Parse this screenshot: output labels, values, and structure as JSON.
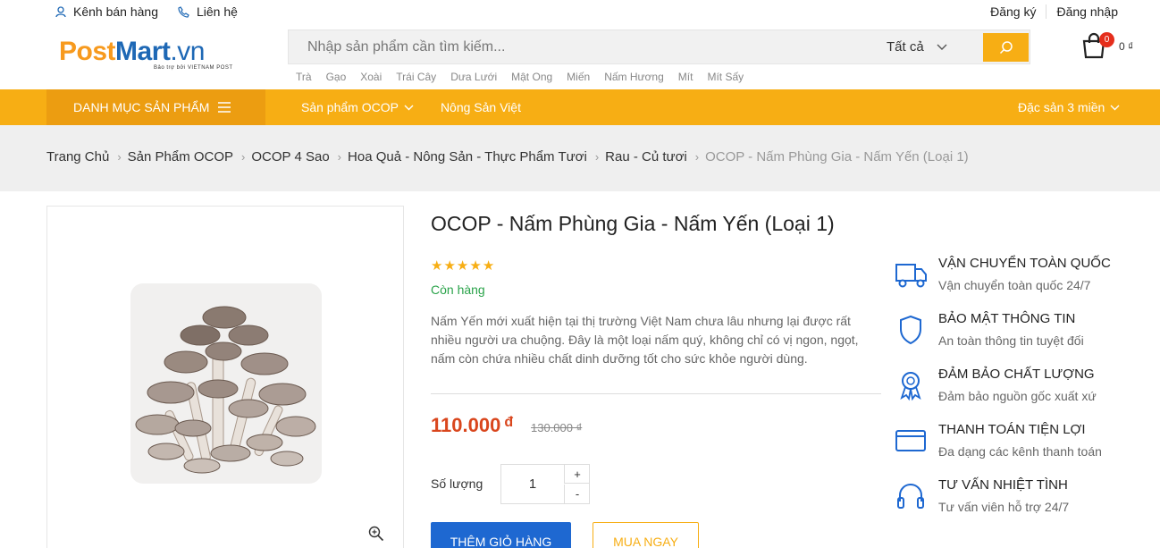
{
  "topbar": {
    "seller_channel": "Kênh bán hàng",
    "contact": "Liên hệ",
    "register": "Đăng ký",
    "login": "Đăng nhập"
  },
  "logo": {
    "part1": "Post",
    "part2": "Mart",
    "part3": ".vn",
    "tagline": "Bảo trợ bởi VIETNAM POST"
  },
  "search": {
    "placeholder": "Nhập sản phẩm cần tìm kiếm...",
    "category": "Tất cả"
  },
  "tags": [
    "Trà",
    "Gạo",
    "Xoài",
    "Trái Cây",
    "Dưa Lưới",
    "Mật Ong",
    "Miến",
    "Nấm Hương",
    "Mít",
    "Mít Sấy"
  ],
  "cart": {
    "count": "0",
    "total": "0 ₫"
  },
  "nav": {
    "categories": "DANH MỤC SẢN PHẨM",
    "menu": [
      "Sản phẩm OCOP",
      "Nông Sản Việt"
    ],
    "right": "Đặc sản 3 miền"
  },
  "breadcrumb": [
    "Trang Chủ",
    "Sản Phẩm OCOP",
    "OCOP 4 Sao",
    "Hoa Quả - Nông Sản - Thực Phẩm Tươi",
    "Rau - Củ tươi",
    "OCOP - Nấm Phùng Gia - Nấm Yến (Loại 1)"
  ],
  "product": {
    "title": "OCOP - Nấm Phùng Gia - Nấm Yến (Loại 1)",
    "rating": 5,
    "stock": "Còn hàng",
    "description": "Nấm Yến mới xuất hiện tại thị trường Việt Nam chưa lâu nhưng lại được rất nhiều người ưa chuộng. Đây là một loại nấm quý, không chỉ có vị ngon, ngọt, nấm còn chứa nhiều chất dinh dưỡng tốt cho sức khỏe người dùng.",
    "price": "110.000",
    "currency": "đ",
    "old_price": "130.000 ₫",
    "quantity_label": "Số lượng",
    "quantity": "1",
    "plus": "+",
    "minus": "-",
    "add_to_cart": "THÊM GIỎ HÀNG",
    "buy_now": "MUA NGAY"
  },
  "features": [
    {
      "title": "VẬN CHUYỂN TOÀN QUỐC",
      "subtitle": "Vận chuyển toàn quốc 24/7",
      "icon": "truck-icon"
    },
    {
      "title": "BẢO MẬT THÔNG TIN",
      "subtitle": "An toàn thông tin tuyệt đối",
      "icon": "shield-icon"
    },
    {
      "title": "ĐẢM BẢO CHẤT LƯỢNG",
      "subtitle": "Đảm bảo nguồn gốc xuất xứ",
      "icon": "award-icon"
    },
    {
      "title": "THANH TOÁN TIỆN LỢI",
      "subtitle": "Đa dạng các kênh thanh toán",
      "icon": "credit-card-icon"
    },
    {
      "title": "TƯ VẤN NHIỆT TÌNH",
      "subtitle": "Tư vấn viên hỗ trợ 24/7",
      "icon": "headphones-icon"
    }
  ],
  "colors": {
    "accent": "#f7ae14",
    "accent_dark": "#ec9d11",
    "brand_blue": "#1e68b5",
    "button_blue": "#1e68d1",
    "price_red": "#d9461d",
    "stock_green": "#2aa34a"
  }
}
